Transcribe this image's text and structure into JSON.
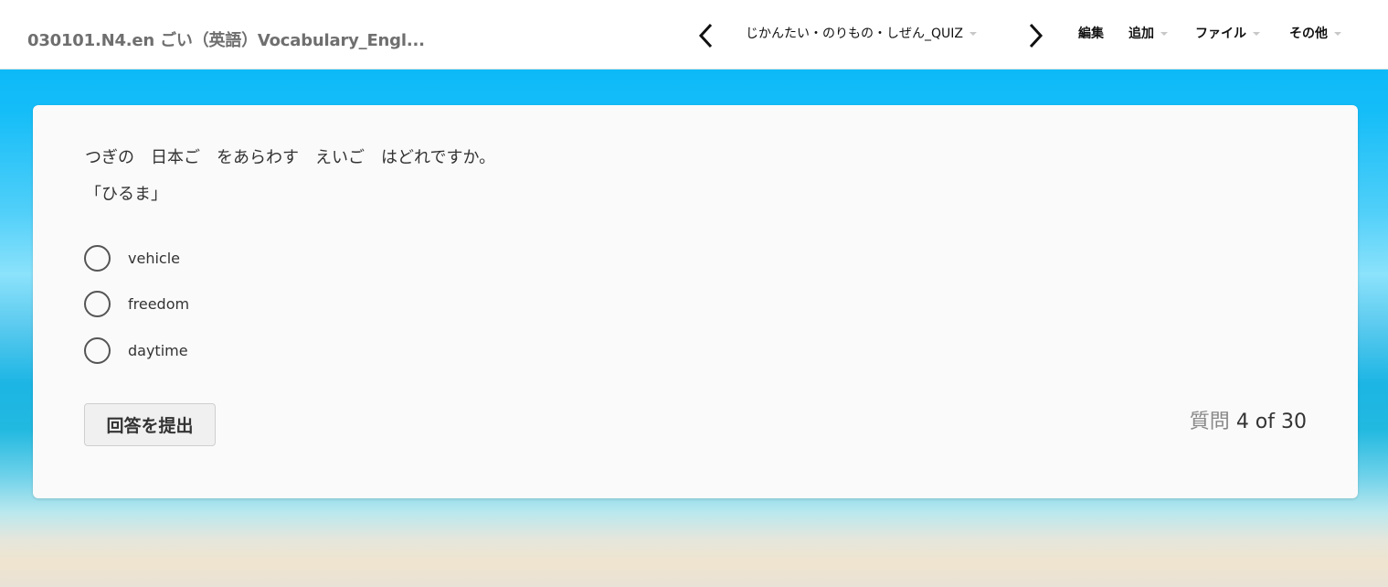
{
  "header": {
    "app_title": "030101.N4.en ごい（英語）Vocabulary_Engl...",
    "quiz_title": "じかんたい・のりもの・しぜん_QUIZ",
    "menu": {
      "edit": "編集",
      "add": "追加",
      "file": "ファイル",
      "other": "その他"
    },
    "icons": {
      "prev": "chevron-left-icon",
      "next": "chevron-right-icon",
      "dropdown": "caret-down-icon"
    }
  },
  "quiz": {
    "question_line1": "つぎの　日本ご　をあらわす　えいご　はどれですか。",
    "question_line2": "「ひるま」",
    "choices": [
      {
        "label": "vehicle",
        "selected": false
      },
      {
        "label": "freedom",
        "selected": false
      },
      {
        "label": "daytime",
        "selected": false
      }
    ],
    "submit_label": "回答を提出",
    "progress_label": "質問",
    "progress_value": "4 of 30",
    "current_question": 4,
    "total_questions": 30
  },
  "colors": {
    "header_bg": "#ffffff",
    "title_text": "#6f6f6f",
    "card_bg": "#fafafa",
    "sky": "#00b4f6",
    "sea": "#1cb5e4",
    "sand": "#efe4cf"
  }
}
